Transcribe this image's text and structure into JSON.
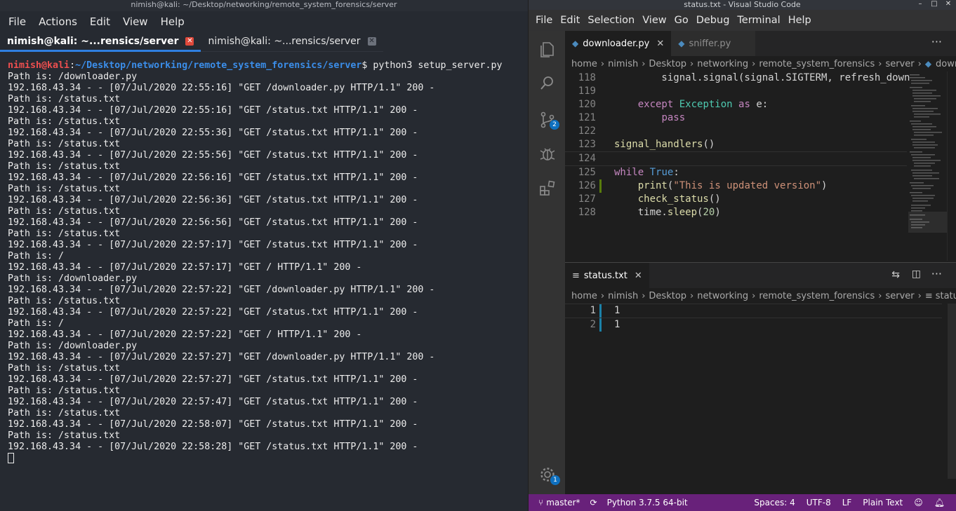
{
  "terminal": {
    "window_title": "nimish@kali: ~/Desktop/networking/remote_system_forensics/server",
    "menu": [
      "File",
      "Actions",
      "Edit",
      "View",
      "Help"
    ],
    "tabs": [
      {
        "label": "nimish@kali: ~...rensics/server",
        "active": true
      },
      {
        "label": "nimish@kali: ~...rensics/server",
        "active": false
      }
    ],
    "prompt_user": "nimish@kali",
    "prompt_sep": ":",
    "prompt_path": "~/Desktop/networking/remote_system_forensics/server",
    "prompt_symbol": "$",
    "command": " python3 setup_server.py",
    "lines": [
      "Path is: /downloader.py",
      "192.168.43.34 - - [07/Jul/2020 22:55:16] \"GET /downloader.py HTTP/1.1\" 200 -",
      "Path is: /status.txt",
      "192.168.43.34 - - [07/Jul/2020 22:55:16] \"GET /status.txt HTTP/1.1\" 200 -",
      "Path is: /status.txt",
      "192.168.43.34 - - [07/Jul/2020 22:55:36] \"GET /status.txt HTTP/1.1\" 200 -",
      "Path is: /status.txt",
      "192.168.43.34 - - [07/Jul/2020 22:55:56] \"GET /status.txt HTTP/1.1\" 200 -",
      "Path is: /status.txt",
      "192.168.43.34 - - [07/Jul/2020 22:56:16] \"GET /status.txt HTTP/1.1\" 200 -",
      "Path is: /status.txt",
      "192.168.43.34 - - [07/Jul/2020 22:56:36] \"GET /status.txt HTTP/1.1\" 200 -",
      "Path is: /status.txt",
      "192.168.43.34 - - [07/Jul/2020 22:56:56] \"GET /status.txt HTTP/1.1\" 200 -",
      "Path is: /status.txt",
      "192.168.43.34 - - [07/Jul/2020 22:57:17] \"GET /status.txt HTTP/1.1\" 200 -",
      "Path is: /",
      "192.168.43.34 - - [07/Jul/2020 22:57:17] \"GET / HTTP/1.1\" 200 -",
      "Path is: /downloader.py",
      "192.168.43.34 - - [07/Jul/2020 22:57:22] \"GET /downloader.py HTTP/1.1\" 200 -",
      "Path is: /status.txt",
      "192.168.43.34 - - [07/Jul/2020 22:57:22] \"GET /status.txt HTTP/1.1\" 200 -",
      "Path is: /",
      "192.168.43.34 - - [07/Jul/2020 22:57:22] \"GET / HTTP/1.1\" 200 -",
      "Path is: /downloader.py",
      "192.168.43.34 - - [07/Jul/2020 22:57:27] \"GET /downloader.py HTTP/1.1\" 200 -",
      "Path is: /status.txt",
      "192.168.43.34 - - [07/Jul/2020 22:57:27] \"GET /status.txt HTTP/1.1\" 200 -",
      "Path is: /status.txt",
      "192.168.43.34 - - [07/Jul/2020 22:57:47] \"GET /status.txt HTTP/1.1\" 200 -",
      "Path is: /status.txt",
      "192.168.43.34 - - [07/Jul/2020 22:58:07] \"GET /status.txt HTTP/1.1\" 200 -",
      "Path is: /status.txt",
      "192.168.43.34 - - [07/Jul/2020 22:58:28] \"GET /status.txt HTTP/1.1\" 200 -"
    ]
  },
  "vscode": {
    "window_title": "status.txt - Visual Studio Code",
    "menu": [
      "File",
      "Edit",
      "Selection",
      "View",
      "Go",
      "Debug",
      "Terminal",
      "Help"
    ],
    "activity_icons": [
      "files-icon",
      "search-icon",
      "source-control-icon",
      "debug-icon",
      "extensions-icon",
      "settings-gear-icon"
    ],
    "scm_badge": "2",
    "settings_badge": "1",
    "editor1": {
      "tabs": [
        {
          "label": "downloader.py",
          "active": true
        },
        {
          "label": "sniffer.py",
          "active": false
        }
      ],
      "breadcrumb": [
        "home",
        "nimish",
        "Desktop",
        "networking",
        "remote_system_forensics",
        "server",
        "downloader.py"
      ],
      "line_numbers": [
        "118",
        "119",
        "120",
        "121",
        "122",
        "123",
        "124",
        "125",
        "126",
        "127",
        "128"
      ],
      "code": {
        "l118_call": "        signal.signal(signal.SIGTERM, refresh_down",
        "l120_except": "except",
        "l120_exc": "Exception",
        "l120_as": "as",
        "l120_var": " e:",
        "l121_pass": "pass",
        "l123_call": "signal_handlers",
        "l123_paren": "()",
        "l125_while": "while",
        "l125_true": "True",
        "l125_colon": ":",
        "l126_print": "print",
        "l126_open": "(",
        "l126_str": "\"This is updated version\"",
        "l126_close": ")",
        "l127_call": "check_status",
        "l127_paren": "()",
        "l128_obj": "time.",
        "l128_fn": "sleep",
        "l128_open": "(",
        "l128_num": "20",
        "l128_close": ")"
      }
    },
    "editor2": {
      "tab": "status.txt",
      "breadcrumb": [
        "home",
        "nimish",
        "Desktop",
        "networking",
        "remote_system_forensics",
        "server",
        "status.txt"
      ],
      "line_numbers": [
        "1",
        "2"
      ],
      "lines": [
        "1",
        "1"
      ]
    },
    "statusbar": {
      "branch": "master*",
      "python": "Python 3.7.5 64-bit",
      "spaces": "Spaces: 4",
      "encoding": "UTF-8",
      "eol": "LF",
      "language": "Plain Text"
    },
    "colors": {
      "statusbar": "#68217a",
      "accent": "#0e70c0"
    }
  }
}
